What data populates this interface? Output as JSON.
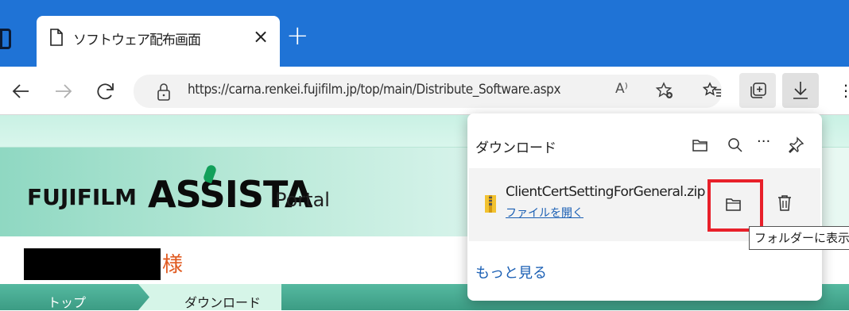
{
  "browser": {
    "tab": {
      "title": "ソフトウェア配布画面",
      "close": "×"
    },
    "new_tab": "+",
    "address": {
      "url": "https://carna.renkei.fujifilm.jp/top/main/Distribute_Software.aspx"
    },
    "read_aloud": "A⁾"
  },
  "page": {
    "brand": "FUJIFILM",
    "product": "ASSISTA",
    "product_suffix": "Portal",
    "honorific": "様",
    "breadcrumb": {
      "home": "トップ",
      "current": "ダウンロード"
    }
  },
  "downloads": {
    "title": "ダウンロード",
    "more": "···",
    "item": {
      "file_name": "ClientCertSettingForGeneral.zip",
      "open_label": "ファイルを開く"
    },
    "tooltip": "フォルダーに表示",
    "see_more": "もっと見る"
  },
  "colors": {
    "tab_strip": "#1f73d6",
    "highlight_box": "#e8202a",
    "link": "#1a5fb4",
    "honorific": "#e05a20"
  }
}
